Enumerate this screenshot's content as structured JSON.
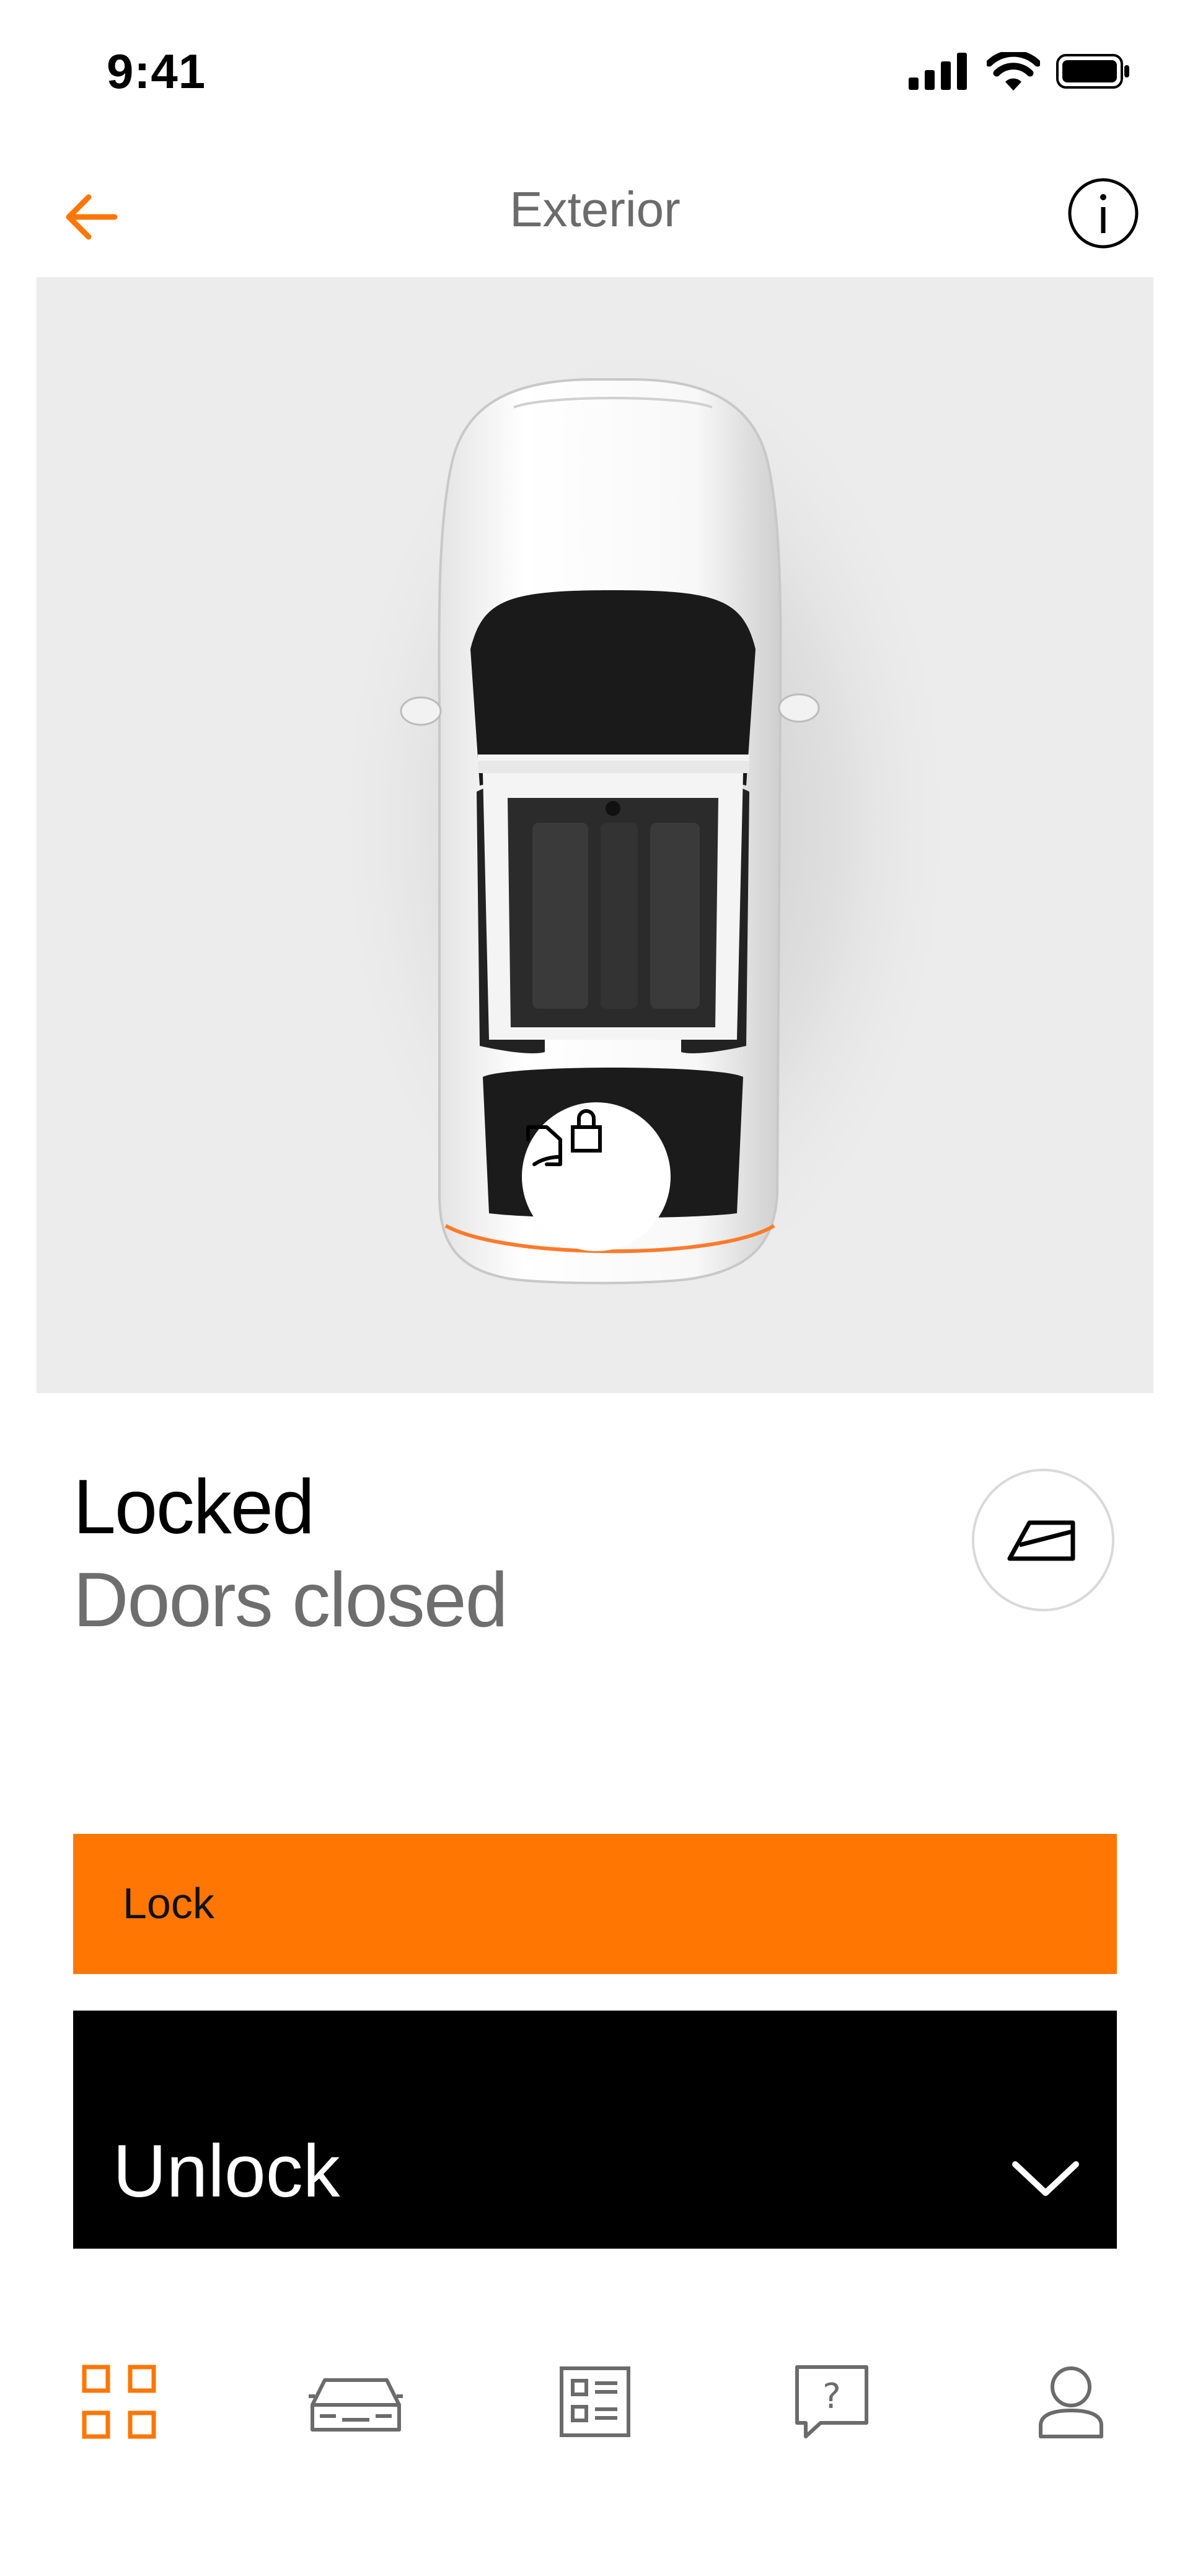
{
  "status_bar": {
    "time": "9:41",
    "icons": [
      "signal-icon",
      "wifi-icon",
      "battery-icon"
    ]
  },
  "header": {
    "title": "Exterior",
    "back_icon": "arrow-left-icon",
    "info_icon": "info-icon"
  },
  "vehicle": {
    "status": "Locked",
    "doors": "Doors closed",
    "lock_badge_icon": "door-lock-icon",
    "window_icon": "window-icon"
  },
  "actions": {
    "lock_label": "Lock",
    "unlock_label": "Unlock",
    "unlock_chevron_icon": "chevron-down-icon"
  },
  "tabs": [
    {
      "icon": "dashboard-grid-icon",
      "active": true
    },
    {
      "icon": "car-icon",
      "active": false
    },
    {
      "icon": "list-icon",
      "active": false
    },
    {
      "icon": "help-icon",
      "active": false
    },
    {
      "icon": "profile-icon",
      "active": false
    }
  ],
  "colors": {
    "accent": "#ff7603",
    "panel_background": "#ececec",
    "inactive_icon": "#6b6b6b"
  }
}
